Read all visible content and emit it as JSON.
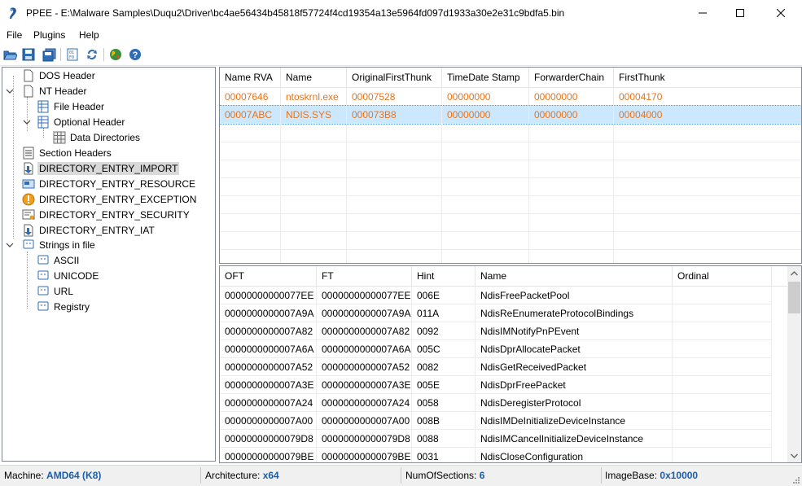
{
  "window": {
    "title": "PPEE - E:\\Malware Samples\\Duqu2\\Driver\\bc4ae56434b45818f57724f4cd19354a13e5964fd097d1933a30e2e31c9bdfa5.bin",
    "controls": [
      "minimize-icon",
      "maximize-icon",
      "close-icon"
    ]
  },
  "menu": {
    "file": "File",
    "plugins": "Plugins",
    "help": "Help"
  },
  "toolbar": {
    "buttons": [
      "open-folder-icon",
      "save-icon",
      "save-all-icon",
      "hex-view-icon",
      "refresh-icon",
      "web-icon",
      "help-icon"
    ]
  },
  "tree": {
    "dos_header": "DOS Header",
    "nt_header": "NT Header",
    "file_header": "File Header",
    "optional_header": "Optional Header",
    "data_directories": "Data Directories",
    "section_headers": "Section Headers",
    "dir_import": "DIRECTORY_ENTRY_IMPORT",
    "dir_resource": "DIRECTORY_ENTRY_RESOURCE",
    "dir_exception": "DIRECTORY_ENTRY_EXCEPTION",
    "dir_security": "DIRECTORY_ENTRY_SECURITY",
    "dir_iat": "DIRECTORY_ENTRY_IAT",
    "strings": "Strings in file",
    "ascii": "ASCII",
    "unicode": "UNICODE",
    "url": "URL",
    "registry": "Registry"
  },
  "imports": {
    "columns": [
      "Name RVA",
      "Name",
      "OriginalFirstThunk",
      "TimeDate Stamp",
      "ForwarderChain",
      "FirstThunk"
    ],
    "rows": [
      [
        "00007646",
        "ntoskrnl.exe",
        "00007528",
        "00000000",
        "00000000",
        "00004170"
      ],
      [
        "00007ABC",
        "NDIS.SYS",
        "000073B8",
        "00000000",
        "00000000",
        "00004000"
      ]
    ],
    "selected_row": 1,
    "text_color": "#e8741b"
  },
  "functions": {
    "columns": [
      "OFT",
      "FT",
      "Hint",
      "Name",
      "Ordinal"
    ],
    "rows": [
      [
        "00000000000077EE",
        "00000000000077EE",
        "006E",
        "NdisFreePacketPool",
        ""
      ],
      [
        "0000000000007A9A",
        "0000000000007A9A",
        "011A",
        "NdisReEnumerateProtocolBindings",
        ""
      ],
      [
        "0000000000007A82",
        "0000000000007A82",
        "0092",
        "NdisIMNotifyPnPEvent",
        ""
      ],
      [
        "0000000000007A6A",
        "0000000000007A6A",
        "005C",
        "NdisDprAllocatePacket",
        ""
      ],
      [
        "0000000000007A52",
        "0000000000007A52",
        "0082",
        "NdisGetReceivedPacket",
        ""
      ],
      [
        "0000000000007A3E",
        "0000000000007A3E",
        "005E",
        "NdisDprFreePacket",
        ""
      ],
      [
        "0000000000007A24",
        "0000000000007A24",
        "0058",
        "NdisDeregisterProtocol",
        ""
      ],
      [
        "0000000000007A00",
        "0000000000007A00",
        "008B",
        "NdisIMDeInitializeDeviceInstance",
        ""
      ],
      [
        "00000000000079D8",
        "00000000000079D8",
        "0088",
        "NdisIMCancelInitializeDeviceInstance",
        ""
      ],
      [
        "00000000000079BE",
        "00000000000079BE",
        "0031",
        "NdisCloseConfiguration",
        ""
      ]
    ]
  },
  "status": {
    "machine_label": "Machine:",
    "machine_value": "AMD64 (K8)",
    "arch_label": "Architecture:",
    "arch_value": "x64",
    "sections_label": "NumOfSections:",
    "sections_value": "6",
    "imagebase_label": "ImageBase:",
    "imagebase_value": "0x10000",
    "value_color": "#1a5ea8"
  }
}
